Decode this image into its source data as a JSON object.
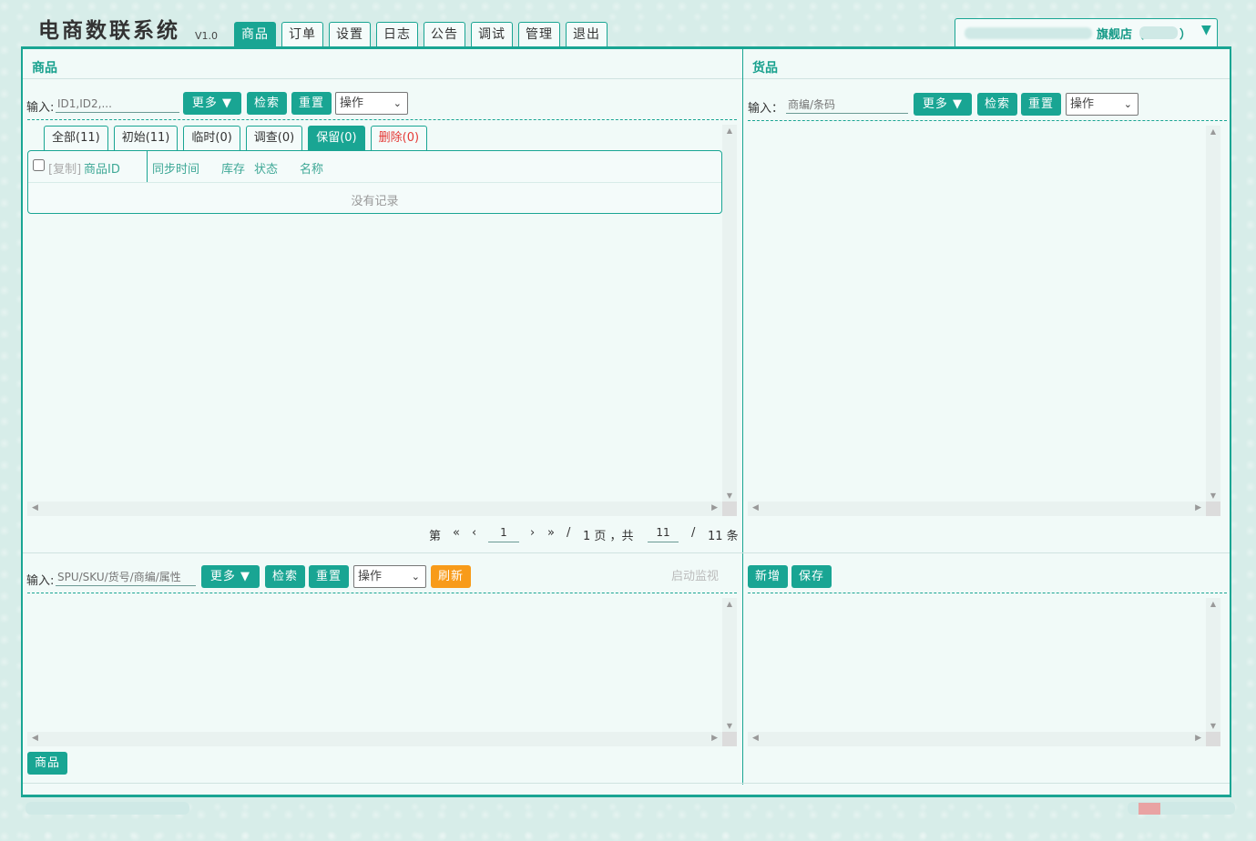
{
  "app": {
    "title": "电商数联系统",
    "version": "V1.0"
  },
  "main_tabs": [
    {
      "label": "商品",
      "active": true
    },
    {
      "label": "订单",
      "active": false
    },
    {
      "label": "设置",
      "active": false
    },
    {
      "label": "日志",
      "active": false
    },
    {
      "label": "公告",
      "active": false
    },
    {
      "label": "调试",
      "active": false
    },
    {
      "label": "管理",
      "active": false
    },
    {
      "label": "退出",
      "active": false
    }
  ],
  "store": {
    "label": "旗舰店（",
    "close_paren": "）",
    "dropdown_icon": "triangle-down-icon"
  },
  "goods_panel": {
    "title": "商品",
    "input_label": "输入:",
    "input_placeholder": "ID1,ID2,...",
    "more_button": "更多 ▼",
    "search_button": "检索",
    "reset_button": "重置",
    "action_select": "操作",
    "sub_tabs": [
      {
        "label": "全部(11)",
        "active": false
      },
      {
        "label": "初始(11)",
        "active": false
      },
      {
        "label": "临时(0)",
        "active": false
      },
      {
        "label": "调查(0)",
        "active": false
      },
      {
        "label": "保留(0)",
        "active": true
      },
      {
        "label": "删除(0)",
        "active": false,
        "color": "#e53935"
      }
    ],
    "table": {
      "copy_label": "[复制]",
      "columns": [
        "商品ID",
        "同步时间",
        "库存",
        "状态",
        "名称"
      ],
      "empty_text": "没有记录"
    },
    "pager": {
      "page_prefix": "第",
      "first": "«",
      "prev": "‹",
      "current_page": "1",
      "next": "›",
      "last": "»",
      "slash1": "/",
      "pages_text": "1 页 ，共",
      "page_size": "11",
      "slash2": "/",
      "total_text": "11 条"
    }
  },
  "cargo_panel": {
    "title": "货品",
    "input_label": "输入：",
    "input_placeholder": "商编/条码",
    "more_button": "更多 ▼",
    "search_button": "检索",
    "reset_button": "重置",
    "action_select": "操作"
  },
  "sku_panel": {
    "input_label": "输入:",
    "input_placeholder": "SPU/SKU/货号/商编/属性",
    "more_button": "更多 ▼",
    "search_button": "检索",
    "reset_button": "重置",
    "action_select": "操作",
    "refresh_button": "刷新",
    "monitor_text": "启动监视",
    "bottom_button": "商品"
  },
  "edit_panel": {
    "add_button": "新增",
    "save_button": "保存"
  },
  "colors": {
    "accent": "#19a593",
    "orange": "#f89b1a",
    "danger": "#e53935",
    "background": "#d7ede9"
  }
}
